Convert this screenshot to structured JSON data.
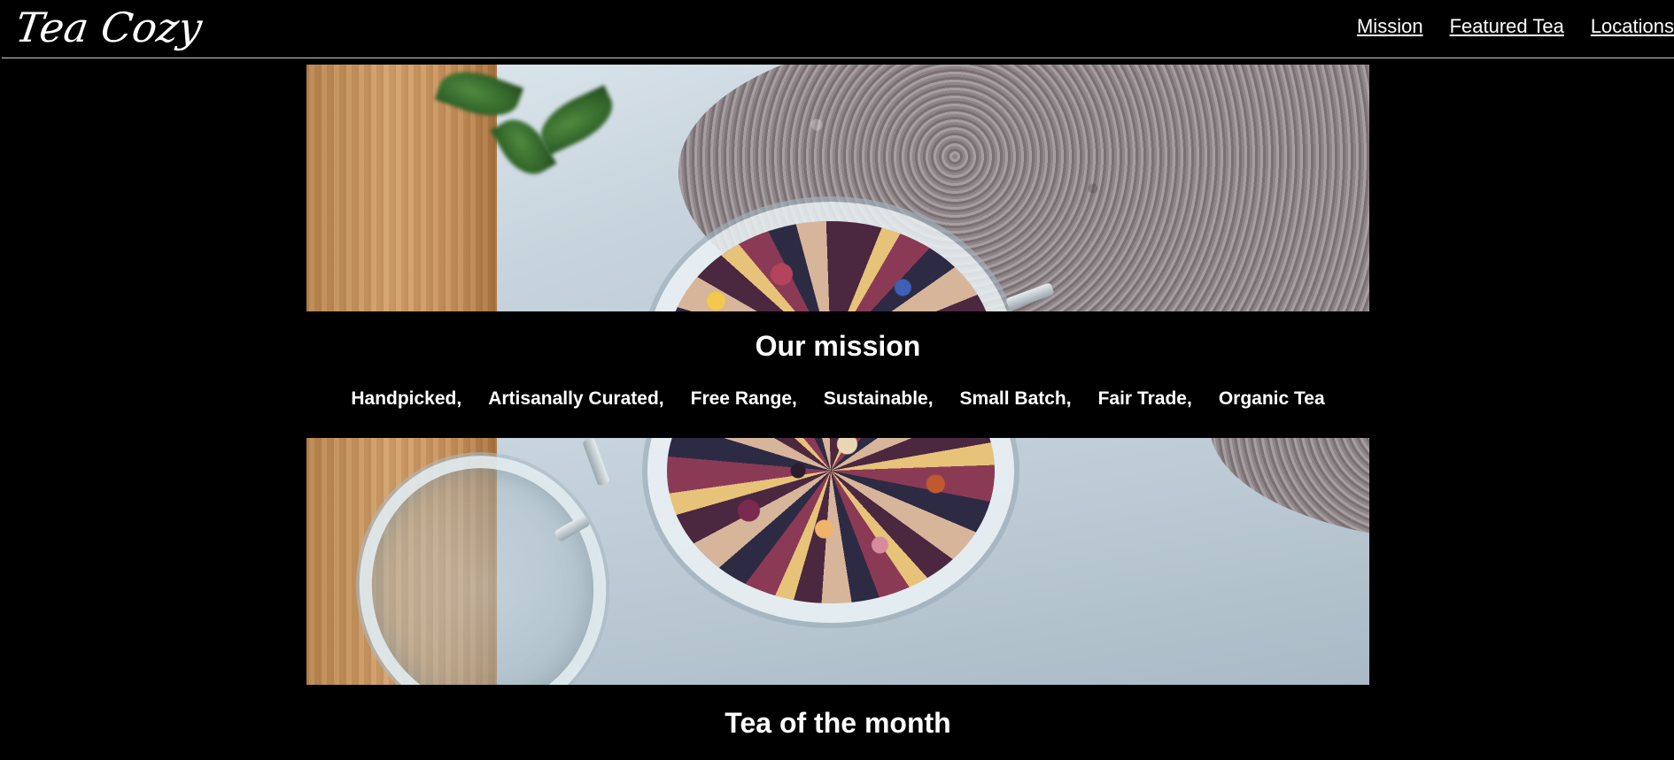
{
  "header": {
    "logo_text": "Tea Cozy",
    "nav": [
      {
        "label": "Mission"
      },
      {
        "label": "Featured Tea"
      },
      {
        "label": "Locations"
      }
    ]
  },
  "mission": {
    "title": "Our mission",
    "values": [
      "Handpicked,",
      "Artisanally Curated,",
      "Free Range,",
      "Sustainable,",
      "Small Batch,",
      "Fair Trade,",
      "Organic Tea"
    ]
  },
  "tea_of_month": {
    "title": "Tea of the month"
  },
  "colors": {
    "background": "#000000",
    "text": "#ffffff",
    "divider": "#cfcfcf"
  }
}
